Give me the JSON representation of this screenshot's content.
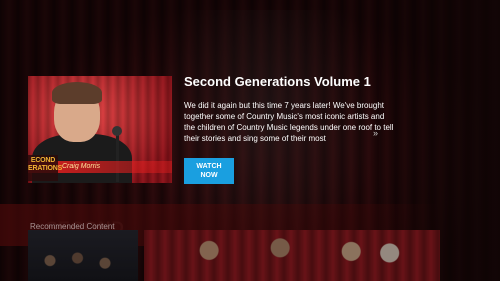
{
  "featured": {
    "title": "Second Generations Volume 1",
    "description": "We did it again but this time 7 years later! We've brought together some of Country Music's most iconic artists and the children of Country Music legends under one roof to tell their stories and sing some of their most",
    "more_icon": "double-chevron-right-icon",
    "watch_button_label": "WATCH NOW",
    "thumbnail": {
      "lower_third_name": "Craig Morris",
      "logo_line1": "ECOND",
      "logo_line2": "ERATIONS"
    }
  },
  "background": {
    "banner_text": "SECOND"
  },
  "recommended": {
    "label": "Recommended Content"
  },
  "colors": {
    "accent": "#1a9fe0",
    "curtain": "#e0222e"
  }
}
